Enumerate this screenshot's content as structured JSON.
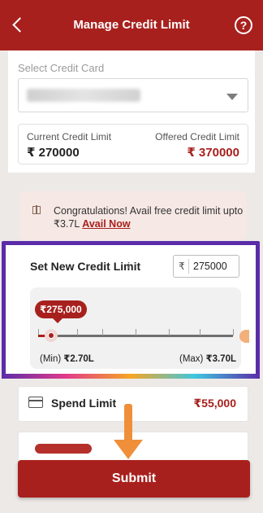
{
  "header": {
    "title": "Manage Credit Limit",
    "help_symbol": "?"
  },
  "card_select": {
    "label": "Select Credit Card"
  },
  "limits": {
    "current_label": "Current Credit Limit",
    "current_value": "₹ 270000",
    "offered_label": "Offered Credit Limit",
    "offered_value": "₹ 370000"
  },
  "promo": {
    "text": "Congratulations! Avail free credit limit upto ₹3.7L ",
    "link": "Avail Now"
  },
  "set_limit": {
    "title": "Set New Credit Limit",
    "info_symbol": "i",
    "currency": "₹",
    "input_value": "275000",
    "bubble": "₹275,000",
    "min_prefix": "(Min) ",
    "min_value": "₹2.70L",
    "max_prefix": "(Max) ",
    "max_value": "₹3.70L",
    "level_fraction": 0.05,
    "tick_fractions": [
      0,
      0.2,
      0.33,
      0.5,
      0.67,
      0.83,
      1.0
    ]
  },
  "spend_limit": {
    "label": "Spend Limit",
    "value": "₹55,000"
  },
  "submit": {
    "label": "Submit"
  },
  "colors": {
    "brand": "#a8201d",
    "highlight": "#5b2ca8",
    "arrow": "#ef8f3a"
  }
}
